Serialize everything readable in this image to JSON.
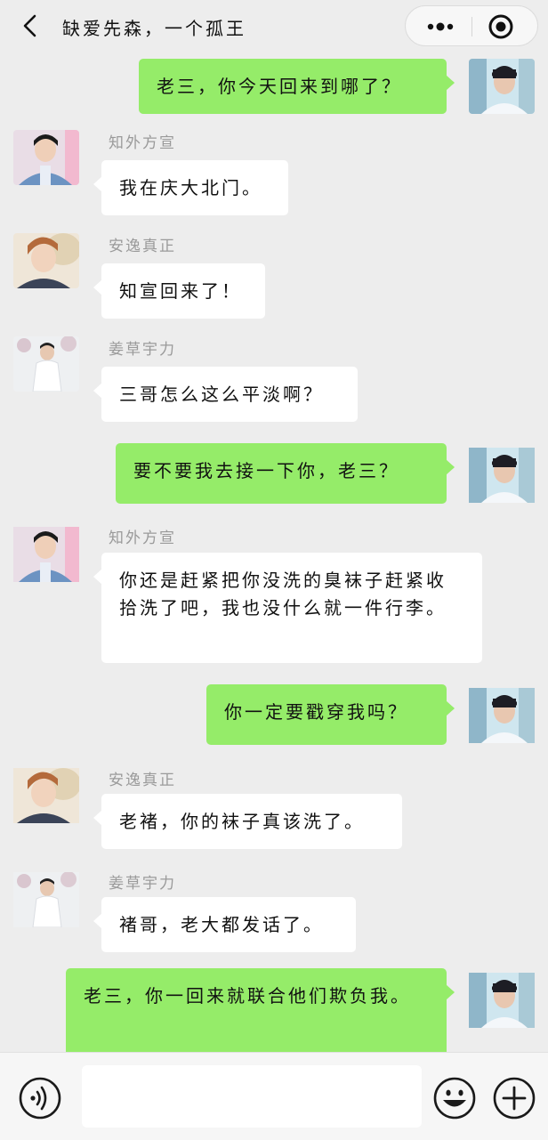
{
  "header": {
    "title": "缺爱先森，一个孤王",
    "back_icon": "chevron-left-icon",
    "more_icon": "more-dots-icon",
    "close_icon": "target-close-icon"
  },
  "messages": [
    {
      "direction": "out",
      "sender": "",
      "text": "老三，你今天回来到哪了？",
      "avatar": "avatar-self"
    },
    {
      "direction": "in",
      "sender": "知外方宣",
      "text": "我在庆大北门。",
      "avatar": "avatar-zhiwai"
    },
    {
      "direction": "in",
      "sender": "安逸真正",
      "text": "知宣回来了！",
      "avatar": "avatar-anyi"
    },
    {
      "direction": "in",
      "sender": "姜草宇力",
      "text": "三哥怎么这么平淡啊？",
      "avatar": "avatar-jiangcao"
    },
    {
      "direction": "out",
      "sender": "",
      "text": "要不要我去接一下你，老三？",
      "avatar": "avatar-self"
    },
    {
      "direction": "in",
      "sender": "知外方宣",
      "text": "你还是赶紧把你没洗的臭袜子赶紧收拾洗了吧，我也没什么就一件行李。",
      "avatar": "avatar-zhiwai"
    },
    {
      "direction": "out",
      "sender": "",
      "text": "你一定要戳穿我吗？",
      "avatar": "avatar-self"
    },
    {
      "direction": "in",
      "sender": "安逸真正",
      "text": "老褚，你的袜子真该洗了。",
      "avatar": "avatar-anyi"
    },
    {
      "direction": "in",
      "sender": "姜草宇力",
      "text": "褚哥，老大都发话了。",
      "avatar": "avatar-jiangcao"
    },
    {
      "direction": "out",
      "sender": "",
      "text": "老三，你一回来就联合他们欺负我。",
      "avatar": "avatar-self"
    }
  ],
  "footer": {
    "input_value": "",
    "voice_icon": "voice-icon",
    "emoji_icon": "emoji-icon",
    "plus_icon": "plus-icon"
  },
  "colors": {
    "background": "#ededed",
    "outgoing_bubble": "#95ec69",
    "incoming_bubble": "#ffffff",
    "sender_name": "#9a9a9a"
  }
}
